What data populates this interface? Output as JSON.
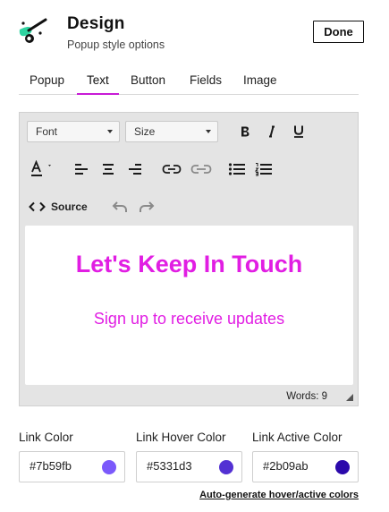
{
  "header": {
    "title": "Design",
    "subtitle": "Popup style options",
    "done_label": "Done",
    "logo_icon": "paint-brush-icon"
  },
  "tabs": [
    {
      "label": "Popup",
      "active": false
    },
    {
      "label": "Text",
      "active": true
    },
    {
      "label": "Button",
      "active": false
    },
    {
      "label": "Fields",
      "active": false
    },
    {
      "label": "Image",
      "active": false
    }
  ],
  "toolbar": {
    "font_select": "Font",
    "size_select": "Size",
    "source_label": "Source",
    "icons": [
      "bold-icon",
      "italic-icon",
      "underline-icon",
      "text-color-icon",
      "align-left-icon",
      "align-center-icon",
      "align-right-icon",
      "link-icon",
      "unlink-icon",
      "bullet-list-icon",
      "numbered-list-icon",
      "source-code-icon",
      "undo-icon",
      "redo-icon"
    ]
  },
  "content": {
    "heading": "Let's Keep In Touch",
    "subheading": "Sign up to receive updates",
    "text_color": "#e11ee3"
  },
  "status": {
    "word_count": "Words: 9"
  },
  "colors": {
    "link": {
      "label": "Link Color",
      "value": "#7b59fb",
      "swatch": "#7b59fb"
    },
    "hover": {
      "label": "Link Hover Color",
      "value": "#5331d3",
      "swatch": "#5331d3"
    },
    "active": {
      "label": "Link Active Color",
      "value": "#2b09ab",
      "swatch": "#2b09ab"
    }
  },
  "autogen_label": "Auto-generate hover/active colors",
  "accent_color": "#c81bd6"
}
